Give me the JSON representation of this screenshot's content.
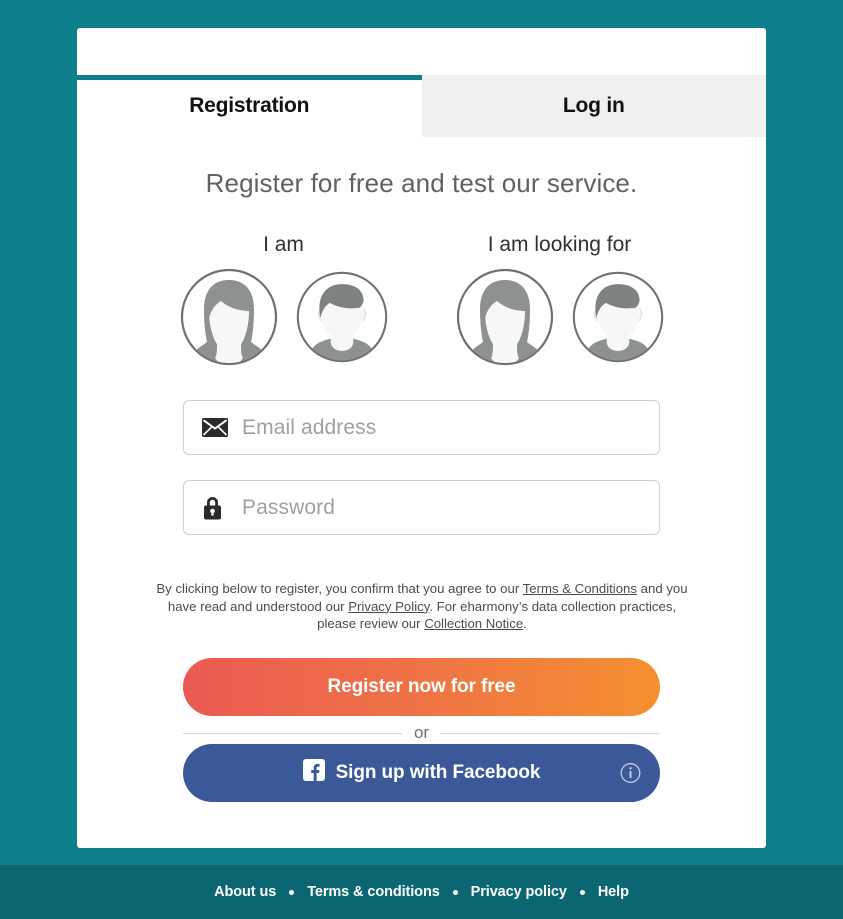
{
  "theme": {
    "page_bg": "#0d808c",
    "footer_bg": "#0a6670",
    "tab_accent": "#0d7c86",
    "facebook_blue": "#3b5998",
    "cta_gradient_from": "#ea5a52",
    "cta_gradient_to": "#f4902f"
  },
  "tabs": {
    "registration": "Registration",
    "login": "Log in"
  },
  "headline": "Register for free and test our service.",
  "gender": {
    "self_label": "I am",
    "seeking_label": "I am looking for",
    "self_options": [
      {
        "value": "female",
        "icon": "female-avatar-icon",
        "selected": true
      },
      {
        "value": "male",
        "icon": "male-avatar-icon",
        "selected": false
      }
    ],
    "seeking_options": [
      {
        "value": "female",
        "icon": "female-avatar-icon",
        "selected": true
      },
      {
        "value": "male",
        "icon": "male-avatar-icon",
        "selected": false
      }
    ]
  },
  "form": {
    "email": {
      "value": "",
      "placeholder": "Email address",
      "icon": "envelope-icon"
    },
    "password": {
      "value": "",
      "placeholder": "Password",
      "icon": "lock-icon"
    }
  },
  "legal": {
    "part1": "By clicking below to register, you confirm that you agree to our ",
    "link1": "Terms & Conditions",
    "part2": " and you have read and understood our ",
    "link2": "Privacy Policy",
    "part3": ". For eharmony’s data collection practices, please review our ",
    "link3": "Collection Notice",
    "part4": "."
  },
  "buttons": {
    "register": "Register now for free",
    "facebook": "Sign up with Facebook",
    "facebook_icon": "facebook-f-icon",
    "facebook_info_icon": "info-circle-icon"
  },
  "divider": {
    "or": "or"
  },
  "footer": {
    "links": [
      "About us",
      "Terms & conditions",
      "Privacy policy",
      "Help"
    ]
  }
}
